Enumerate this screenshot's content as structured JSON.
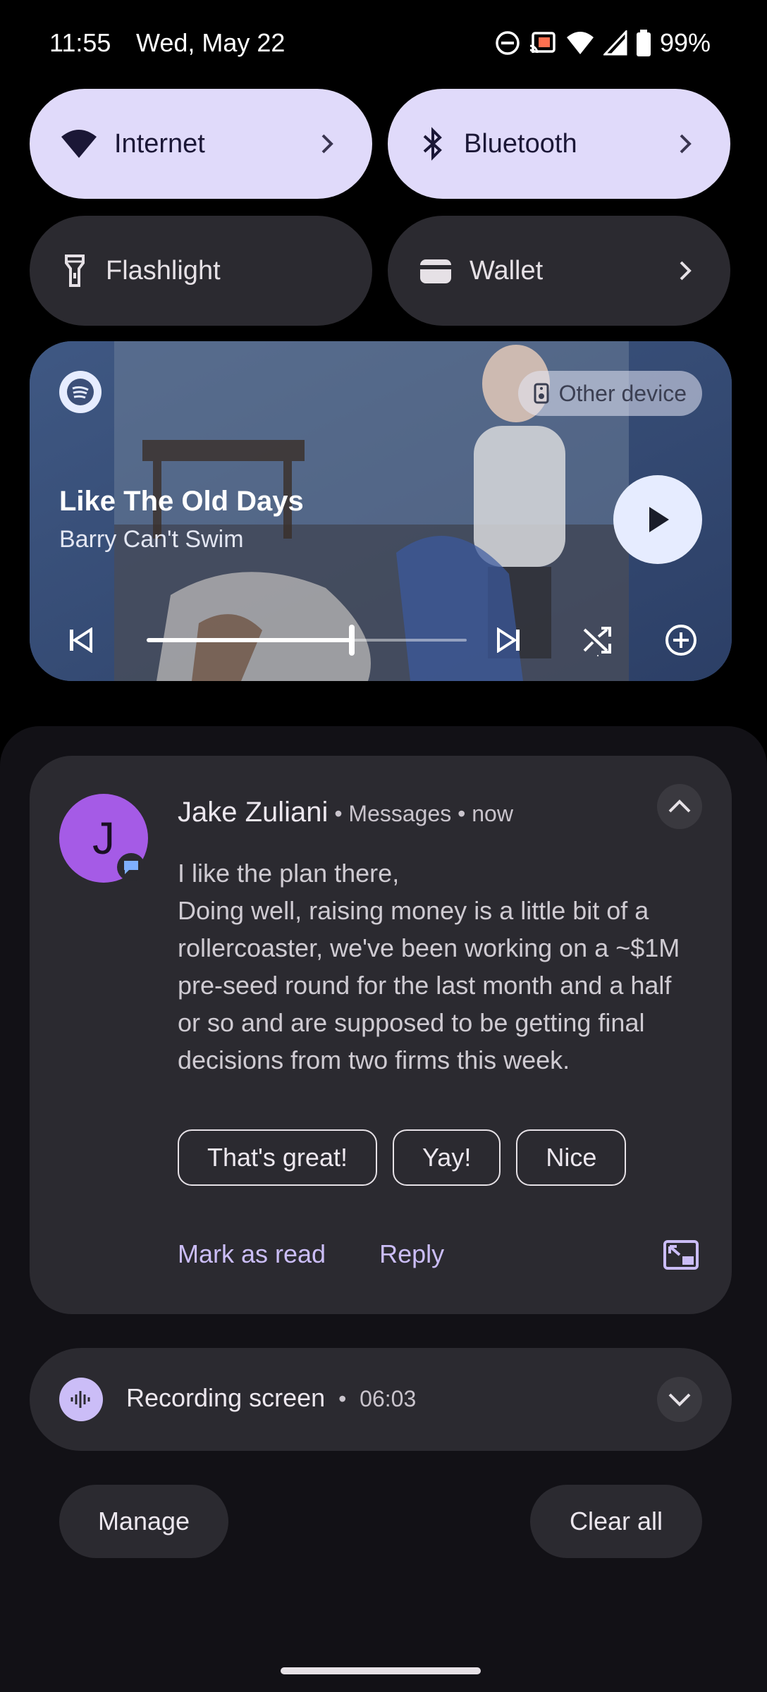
{
  "status_bar": {
    "time": "11:55",
    "date": "Wed, May 22",
    "battery": "99%",
    "icons": [
      "do-not-disturb-icon",
      "cast-icon",
      "wifi-icon",
      "cell-signal-icon",
      "battery-icon"
    ]
  },
  "quick_settings": {
    "tiles": [
      {
        "label": "Internet",
        "icon": "wifi-icon",
        "active": true,
        "has_chevron": true
      },
      {
        "label": "Bluetooth",
        "icon": "bluetooth-icon",
        "active": true,
        "has_chevron": true
      },
      {
        "label": "Flashlight",
        "icon": "flashlight-icon",
        "active": false,
        "has_chevron": false
      },
      {
        "label": "Wallet",
        "icon": "wallet-icon",
        "active": false,
        "has_chevron": true
      }
    ]
  },
  "media": {
    "app_icon": "spotify-icon",
    "output_device": "Other device",
    "title": "Like The Old Days",
    "artist": "Barry Can't Swim",
    "progress": 0.64,
    "controls": [
      "previous-icon",
      "play-icon",
      "next-icon",
      "shuffle-icon",
      "add-icon"
    ]
  },
  "notification": {
    "avatar_letter": "J",
    "sender": "Jake Zuliani",
    "app": "Messages",
    "time": "now",
    "message_lines": [
      "I like the plan there,",
      "Doing well, raising money is a little bit of a",
      "rollercoaster, we've been working on a ~$1M",
      "pre-seed round for the last month and a half",
      "or so and are supposed to be getting final",
      "decisions from two firms this week."
    ],
    "smart_replies": [
      "That's great!",
      "Yay!",
      "Nice"
    ],
    "actions": {
      "mark_read": "Mark as read",
      "reply": "Reply"
    }
  },
  "recording": {
    "title": "Recording screen",
    "duration": "06:03"
  },
  "footer": {
    "manage": "Manage",
    "clear_all": "Clear all"
  },
  "colors": {
    "tile_active": "#e0dafa",
    "tile_inactive": "#2b2a30",
    "accent": "#cbbdf7",
    "avatar": "#a55be6"
  }
}
